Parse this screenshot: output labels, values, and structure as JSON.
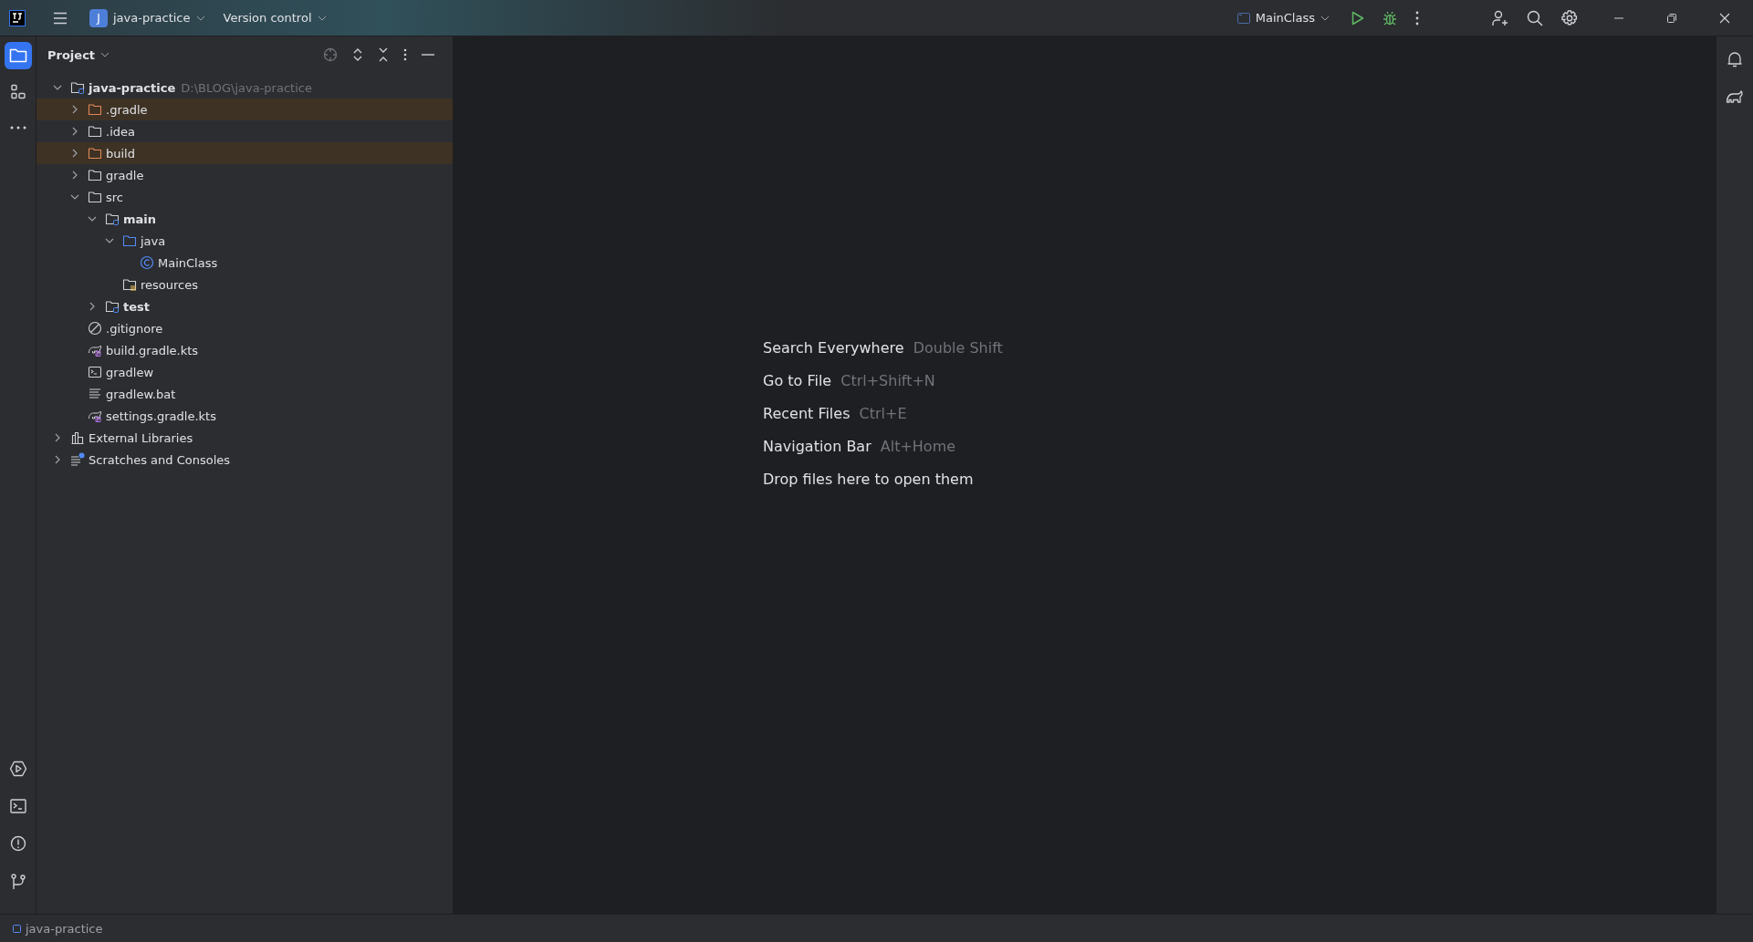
{
  "title_bar": {
    "project": {
      "initial": "J",
      "name": "java-practice"
    },
    "vcs": "Version control",
    "run_config": "MainClass"
  },
  "tool_strip": [
    {
      "kind": "project",
      "selected": true
    },
    {
      "kind": "structure",
      "selected": false
    }
  ],
  "project_panel": {
    "title": "Project",
    "tree": [
      {
        "label": "java-practice",
        "path": "D:\\BLOG\\java-practice",
        "kind": "module",
        "expanded": true,
        "children": [
          {
            "label": ".gradle",
            "kind": "folder",
            "excluded": true,
            "expanded": false
          },
          {
            "label": ".idea",
            "kind": "folder",
            "excluded": false,
            "expanded": false
          },
          {
            "label": "build",
            "kind": "folder",
            "excluded": true,
            "expanded": false
          },
          {
            "label": "gradle",
            "kind": "folder",
            "excluded": false,
            "expanded": false
          },
          {
            "label": "src",
            "kind": "folder",
            "excluded": false,
            "expanded": true,
            "children": [
              {
                "label": "main",
                "kind": "module",
                "excluded": false,
                "expanded": true,
                "children": [
                  {
                    "label": "java",
                    "kind": "source",
                    "excluded": false,
                    "expanded": true,
                    "children": [
                      {
                        "label": "MainClass",
                        "kind": "class",
                        "excluded": false
                      }
                    ]
                  },
                  {
                    "label": "resources",
                    "kind": "resources",
                    "excluded": false
                  }
                ]
              },
              {
                "label": "test",
                "kind": "module",
                "excluded": false,
                "expanded": false
              }
            ]
          },
          {
            "label": ".gitignore",
            "kind": "ignore",
            "excluded": false
          },
          {
            "label": "build.gradle.kts",
            "kind": "gradle",
            "excluded": false
          },
          {
            "label": "gradlew",
            "kind": "shell",
            "excluded": false
          },
          {
            "label": "gradlew.bat",
            "kind": "text",
            "excluded": false
          },
          {
            "label": "settings.gradle.kts",
            "kind": "gradle",
            "excluded": false
          }
        ]
      },
      {
        "label": "External Libraries",
        "kind": "libraries",
        "expanded": false
      },
      {
        "label": "Scratches and Consoles",
        "kind": "scratches",
        "expanded": false
      }
    ]
  },
  "welcome_hints": [
    {
      "action": "Search Everywhere",
      "shortcut": "Double Shift"
    },
    {
      "action": "Go to File",
      "shortcut": "Ctrl+Shift+N"
    },
    {
      "action": "Recent Files",
      "shortcut": "Ctrl+E"
    },
    {
      "action": "Navigation Bar",
      "shortcut": "Alt+Home"
    },
    {
      "action": "Drop files here to open them"
    }
  ],
  "status_bar": {
    "breadcrumb": "java-practice"
  }
}
